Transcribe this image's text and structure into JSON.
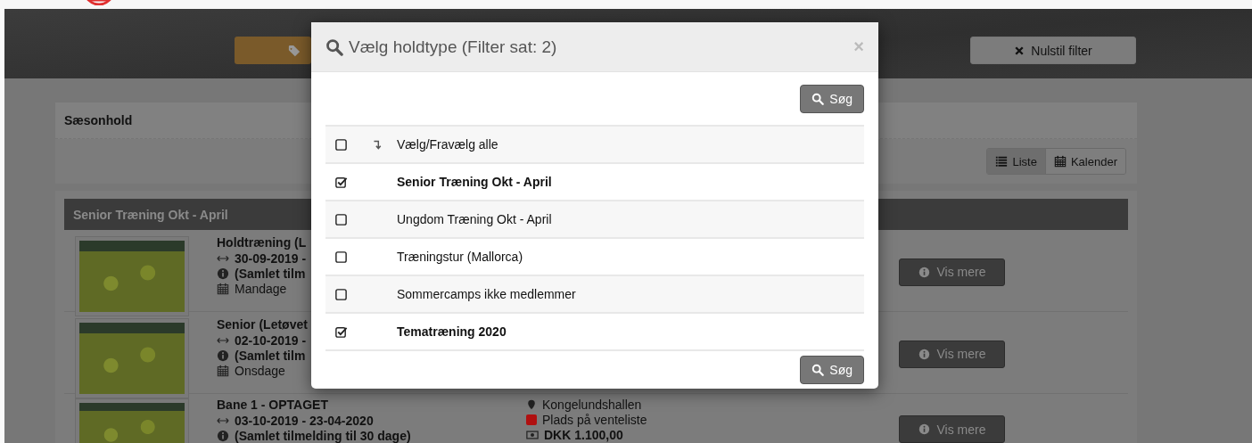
{
  "toolbar": {
    "reset_button": "Nulstil filter"
  },
  "season_panel": {
    "title": "Sæsonhold",
    "view_buttons": [
      {
        "label": "Liste",
        "selected": true,
        "kind": "list"
      },
      {
        "label": "Kalender",
        "selected": false,
        "kind": "calendar"
      }
    ]
  },
  "team_group": {
    "title": "Senior Træning Okt - April",
    "rows": [
      {
        "title": "Holdtræning (L",
        "dates": "30-09-2019 -",
        "info": "(Samlet tilm",
        "day": "Mandage",
        "button": "Vis mere"
      },
      {
        "title": "Senior (Letøvet",
        "dates": "02-10-2019 -",
        "info": "(Samlet tilm",
        "day": "Onsdage",
        "button": "Vis mere"
      },
      {
        "title": "Bane 1 - OPTAGET",
        "dates": "03-10-2019 - 23-04-2020",
        "info": "(Samlet tilmelding til 30 dage)",
        "location": "Kongelundshallen",
        "status": "Plads på venteliste",
        "color": "#b01010",
        "price": "DKK 1.100,00",
        "button": "Vis mere"
      }
    ]
  },
  "modal": {
    "title": "Vælg holdtype (Filter sat: 2)",
    "close": "×",
    "search_button": "Søg",
    "items": [
      {
        "label": "Vælg/Fravælg alle",
        "checked": false,
        "kind": "toggle_all"
      },
      {
        "label": "Senior Træning Okt - April",
        "checked": true,
        "kind": "option"
      },
      {
        "label": "Ungdom Træning Okt - April",
        "checked": false,
        "kind": "option"
      },
      {
        "label": "Træningstur (Mallorca)",
        "checked": false,
        "kind": "option"
      },
      {
        "label": "Sommercamps ikke medlemmer",
        "checked": false,
        "kind": "option"
      },
      {
        "label": "Tematræning 2020",
        "checked": true,
        "kind": "option"
      }
    ],
    "footer_button": "Søg"
  }
}
